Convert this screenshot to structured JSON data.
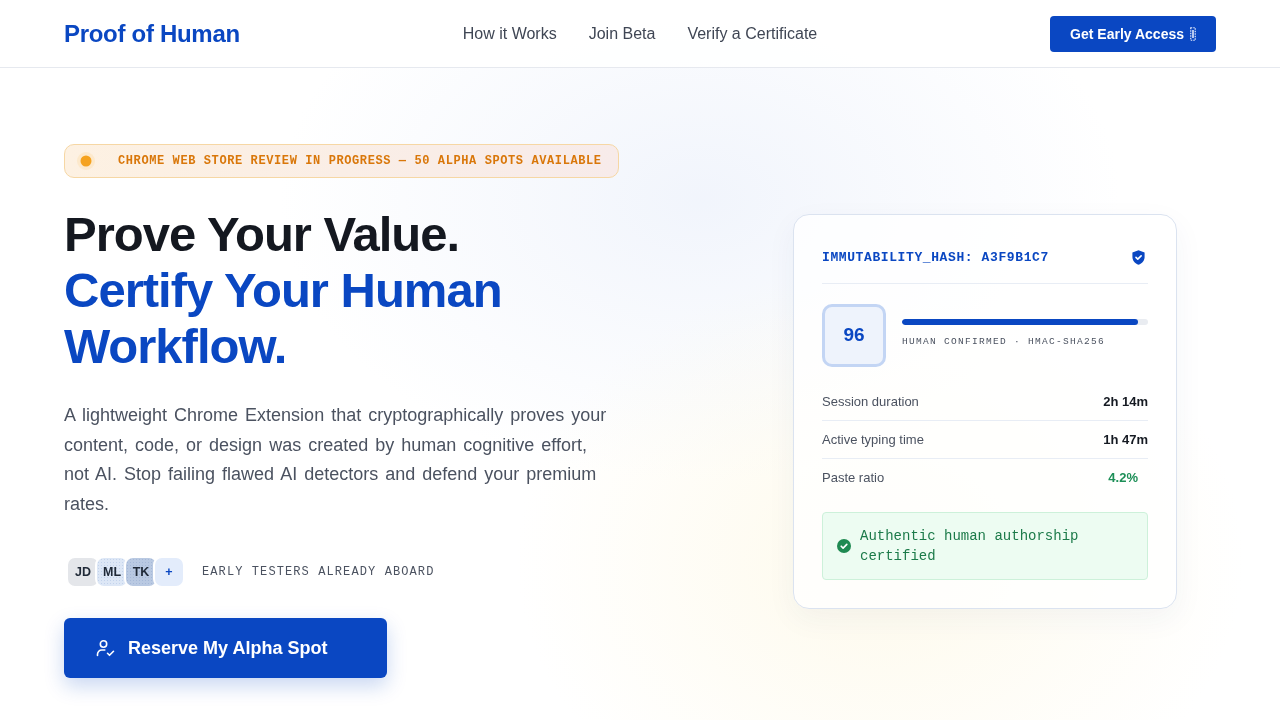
{
  "nav": {
    "logo": "Proof of Human",
    "links": [
      "How it Works",
      "Join Beta",
      "Verify a Certificate"
    ],
    "cta": "Get Early Access"
  },
  "hero": {
    "badge": "CHROME WEB STORE REVIEW IN PROGRESS — 50 ALPHA SPOTS AVAILABLE",
    "headline": [
      {
        "text": "Prove Your Value.",
        "kind": "plain"
      },
      {
        "text": "Certify Your Human Workflow.",
        "kind": "accent"
      }
    ],
    "description": "A lightweight Chrome Extension that cryptographically proves your content, code, or design was created by human cognitive effort, not AI. Stop failing flawed AI detectors and defend your premium rates.",
    "avatars": [
      {
        "label": "JD",
        "kind": "person"
      },
      {
        "label": "ML",
        "kind": "person"
      },
      {
        "label": "TK",
        "kind": "person"
      },
      {
        "label": "+",
        "kind": "more"
      }
    ],
    "testers_note": "EARLY TESTERS ALREADY ABOARD",
    "cta": "Reserve My Alpha Spot"
  },
  "certificate": {
    "hash": "IMMUTABILITY_HASH: A3F9B1C7",
    "score": "96",
    "confidence": {
      "level": 0.96,
      "caption": "HUMAN CONFIRMED · HMAC-SHA256"
    },
    "stats": [
      {
        "label": "Session duration",
        "value": "2h 14m",
        "kind": "plain"
      },
      {
        "label": "Active typing time",
        "value": "1h 47m",
        "kind": "plain"
      },
      {
        "label": "Paste ratio",
        "value": "4.2%",
        "kind": "good"
      }
    ],
    "verdict": "Authentic human authorship certified"
  }
}
